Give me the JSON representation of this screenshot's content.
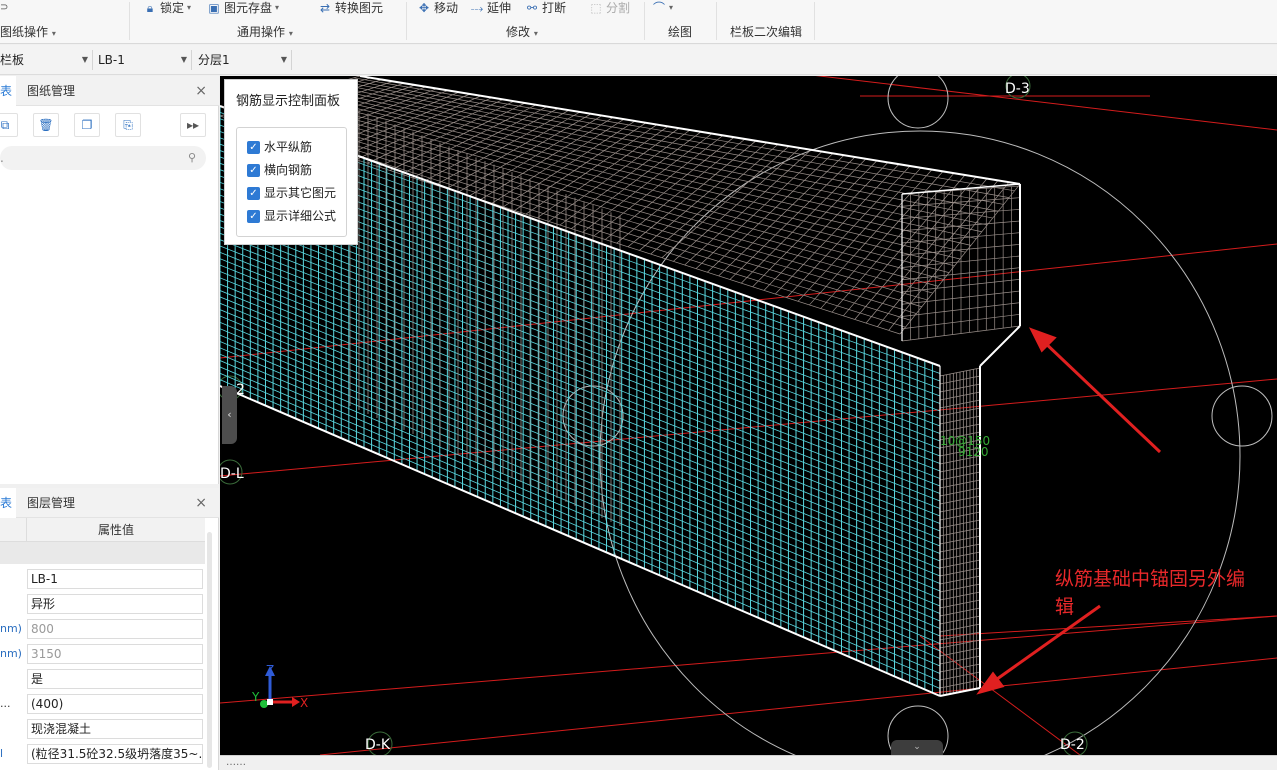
{
  "ribbon": {
    "row1": [
      {
        "label": "锁定",
        "icon": "lock-icon",
        "dropdown": true
      },
      {
        "label": "图元存盘",
        "icon": "save-element-icon",
        "dropdown": true
      },
      {
        "label": "转换图元",
        "icon": "convert-icon"
      },
      {
        "label": "移动",
        "icon": "move-icon"
      },
      {
        "label": "延伸",
        "icon": "extend-icon"
      },
      {
        "label": "打断",
        "icon": "break-icon"
      },
      {
        "label": "分割",
        "icon": "split-icon",
        "disabled": true
      }
    ],
    "groups": {
      "drawing_ops": "图纸操作",
      "common_ops": "通用操作",
      "modify": "修改",
      "draw": "绘图",
      "railing_edit": "栏板二次编辑"
    }
  },
  "toolbar": {
    "type_select": "栏板",
    "name_select": "LB-1",
    "layer_select": "分层1"
  },
  "left_top": {
    "tab_active": "表",
    "tab_other": "图纸管理",
    "close": "×",
    "tools": [
      "new-icon",
      "delete-icon",
      "copy-icon",
      "save-icon",
      "more-icon"
    ],
    "search_placeholder": "."
  },
  "left_bottom": {
    "tab_active": "表",
    "tab_other": "图层管理",
    "close": "×",
    "col_value": "属性值",
    "rows": [
      {
        "key": "",
        "value": "LB-1",
        "muted": false
      },
      {
        "key": "",
        "value": "异形",
        "muted": false
      },
      {
        "key": "nm)",
        "value": "800",
        "muted": true
      },
      {
        "key": "nm)",
        "value": "3150",
        "muted": true
      },
      {
        "key": "",
        "value": "是",
        "muted": false
      },
      {
        "key": "...",
        "value": "(400)",
        "muted": false
      },
      {
        "key": "",
        "value": "现浇混凝土",
        "muted": false
      },
      {
        "key": "l",
        "value": "(粒径31.5砼32.5级坍落度35~...",
        "muted": false
      }
    ]
  },
  "control_panel": {
    "title": "钢筋显示控制面板",
    "options": [
      {
        "label": "水平纵筋",
        "checked": true
      },
      {
        "label": "横向钢筋",
        "checked": true
      },
      {
        "label": "显示其它图元",
        "checked": true
      },
      {
        "label": "显示详细公式",
        "checked": true
      }
    ]
  },
  "viewport": {
    "axis_labels": [
      "D-3",
      "D-L",
      "D-K",
      "D-2",
      "2"
    ],
    "dim_text_1": "10@150",
    "dim_text_2": "9120",
    "axes": {
      "x": "X",
      "y": "Y",
      "z": "Z"
    },
    "annotation_line1": "纵筋基础中锚固另外编",
    "annotation_line2": "辑",
    "colors": {
      "background": "#000000",
      "cyan_rebar": "#5ad8e0",
      "grey_rebar": "#9a8f8a",
      "red_line": "#e02020",
      "annotation": "#e8282a"
    }
  },
  "status": {
    "text": "……"
  }
}
